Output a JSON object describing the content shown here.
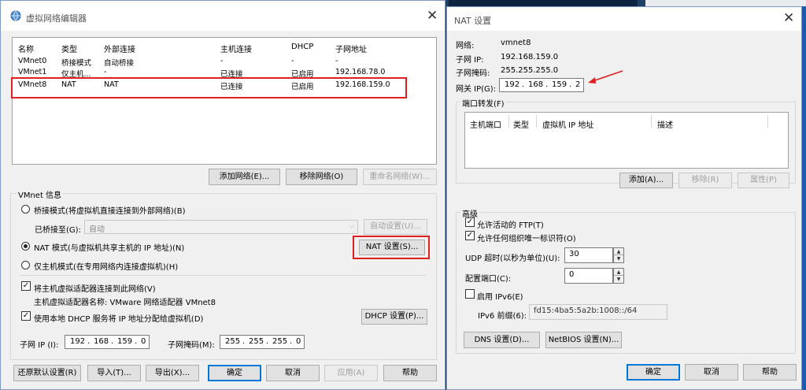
{
  "vne": {
    "title": "虚拟网络编辑器",
    "close": "✕",
    "table": {
      "headers": [
        "名称",
        "类型",
        "外部连接",
        "主机连接",
        "DHCP",
        "子网地址"
      ],
      "rows": [
        [
          "VMnet0",
          "桥接模式",
          "自动桥接",
          "-",
          "-",
          "-"
        ],
        [
          "VMnet1",
          "仅主机...",
          "-",
          "已连接",
          "已启用",
          "192.168.78.0"
        ],
        [
          "VMnet8",
          "NAT",
          "NAT",
          "已连接",
          "已启用",
          "192.168.159.0"
        ]
      ]
    },
    "add_network": "添加网络(E)...",
    "remove_network": "移除网络(O)",
    "rename_network": "重命名网络(W)...",
    "info_label": "VMnet 信息",
    "bridge_mode": "桥接模式(将虚拟机直接连接到外部网络)(B)",
    "bridged_to_label": "已桥接至(G):",
    "bridged_to_value": "自动",
    "auto_settings": "自动设置(U)...",
    "nat_mode": "NAT 模式(与虚拟机共享主机的 IP 地址)(N)",
    "nat_settings": "NAT 设置(S)...",
    "host_only_mode": "仅主机模式(在专用网络内连接虚拟机)(H)",
    "connect_adapter": "将主机虚拟适配器连接到此网络(V)",
    "adapter_name": "主机虚拟适配器名称: VMware 网络适配器 VMnet8",
    "use_dhcp": "使用本地 DHCP 服务将 IP 地址分配给虚拟机(D)",
    "dhcp_settings": "DHCP 设置(P)...",
    "subnet_ip_label": "子网 IP (I):",
    "subnet_ip": [
      "192",
      "168",
      "159",
      "0"
    ],
    "subnet_mask_label": "子网掩码(M):",
    "subnet_mask": [
      "255",
      "255",
      "255",
      "0"
    ],
    "restore_defaults": "还原默认设置(R)",
    "import": "导入(T)...",
    "export": "导出(X)...",
    "ok": "确定",
    "cancel": "取消",
    "apply": "应用(A)",
    "help": "帮助"
  },
  "nat": {
    "title": "NAT 设置",
    "close": "✕",
    "network_label": "网络:",
    "network_value": "vmnet8",
    "subnet_ip_label": "子网 IP:",
    "subnet_ip_value": "192.168.159.0",
    "subnet_mask_label": "子网掩码:",
    "subnet_mask_value": "255.255.255.0",
    "gateway_label": "网关 IP(G):",
    "gateway_ip": [
      "192",
      "168",
      "159",
      "2"
    ],
    "port_forwarding_label": "端口转发(F)",
    "pf_headers": [
      "主机端口",
      "类型",
      "虚拟机 IP 地址",
      "描述"
    ],
    "add": "添加(A)...",
    "remove": "移除(R)",
    "properties": "属性(P)",
    "advanced_label": "高级",
    "allow_ftp": "允许活动的 FTP(T)",
    "allow_oui": "允许任何组织唯一标识符(O)",
    "udp_timeout_label": "UDP 超时(以秒为单位)(U):",
    "udp_timeout_value": "30",
    "config_port_label": "配置端口(C):",
    "config_port_value": "0",
    "enable_ipv6": "启用 IPv6(E)",
    "ipv6_prefix_label": "IPv6 前缀(6):",
    "ipv6_prefix_value": "fd15:4ba5:5a2b:1008::/64",
    "dns_settings": "DNS 设置(D)...",
    "netbios_settings": "NetBIOS 设置(N)...",
    "ok": "确定",
    "cancel": "取消",
    "help": "帮助"
  },
  "colors": {
    "highlight": "#e02020",
    "arrow": "#e02020"
  }
}
